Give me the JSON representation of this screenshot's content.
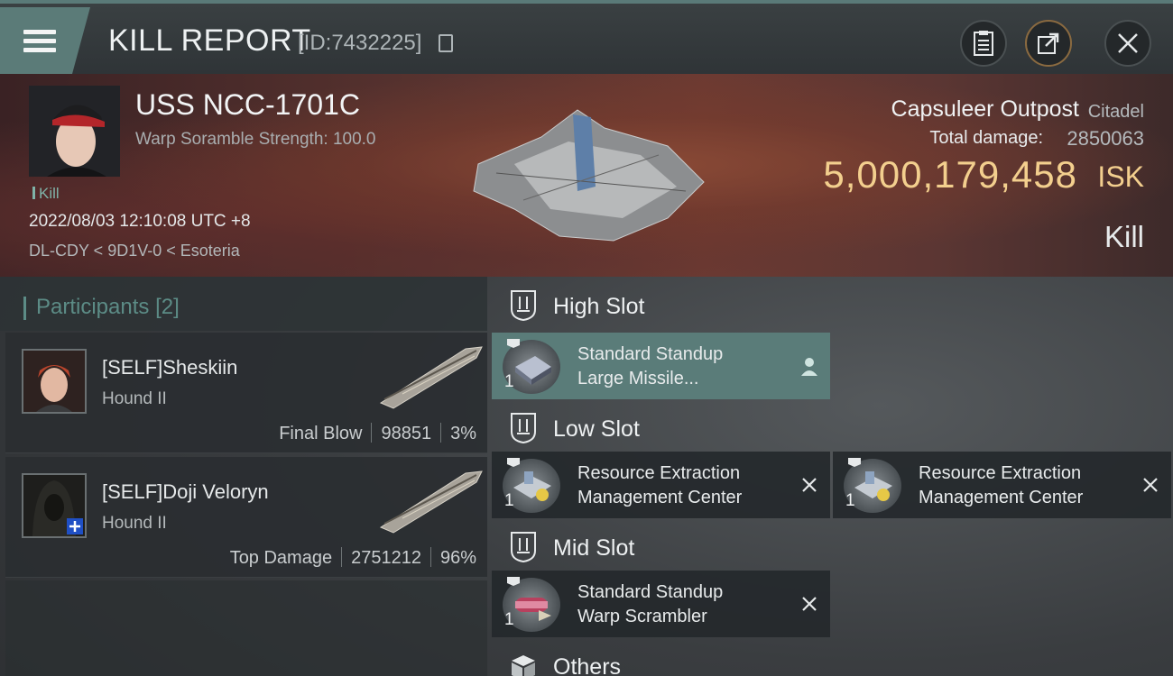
{
  "header": {
    "title": "KILL REPORT",
    "report_id": "[ID:7432225]",
    "buttons": {
      "clipboard": "clipboard-icon",
      "share": "share-icon",
      "close": "close-icon"
    }
  },
  "victim": {
    "ship_name": "USS NCC-1701C",
    "scramble_strength": "Warp Soramble Strength: 100.0",
    "kill_tag": "Kill",
    "datetime": "2022/08/03 12:10:08 UTC +8",
    "location": "DL-CDY < 9D1V-0 < Esoteria",
    "structure_name": "Capsuleer Outpost",
    "structure_type": "Citadel",
    "total_damage_label": "Total damage:",
    "total_damage": "2850063",
    "isk_value": "5,000,179,458",
    "isk_unit": "ISK",
    "result": "Kill"
  },
  "participants": {
    "label": "Participants",
    "count": "[2]",
    "rows": [
      {
        "name": "[SELF]Sheskiin",
        "ship": "Hound II",
        "role": "Final Blow",
        "damage": "98851",
        "percent": "3%"
      },
      {
        "name": "[SELF]Doji Veloryn",
        "ship": "Hound II",
        "role": "Top Damage",
        "damage": "2751212",
        "percent": "96%"
      }
    ]
  },
  "slots": {
    "high": {
      "label": "High Slot",
      "modules": [
        {
          "name_line1": "Standard Standup",
          "name_line2": "Large Missile...",
          "count": "1",
          "action": "person-icon"
        }
      ]
    },
    "low": {
      "label": "Low Slot",
      "modules": [
        {
          "name_line1": "Resource Extraction",
          "name_line2": "Management Center",
          "count": "1",
          "action": "close-icon"
        },
        {
          "name_line1": "Resource Extraction",
          "name_line2": "Management Center",
          "count": "1",
          "action": "close-icon"
        }
      ]
    },
    "mid": {
      "label": "Mid Slot",
      "modules": [
        {
          "name_line1": "Standard Standup",
          "name_line2": "Warp Scrambler",
          "count": "1",
          "action": "close-icon"
        }
      ]
    },
    "others": {
      "label": "Others"
    }
  },
  "colors": {
    "accent_teal": "#5a7c79",
    "isk_gold": "#f3cf8e",
    "participants_teal": "#5c8c86"
  }
}
